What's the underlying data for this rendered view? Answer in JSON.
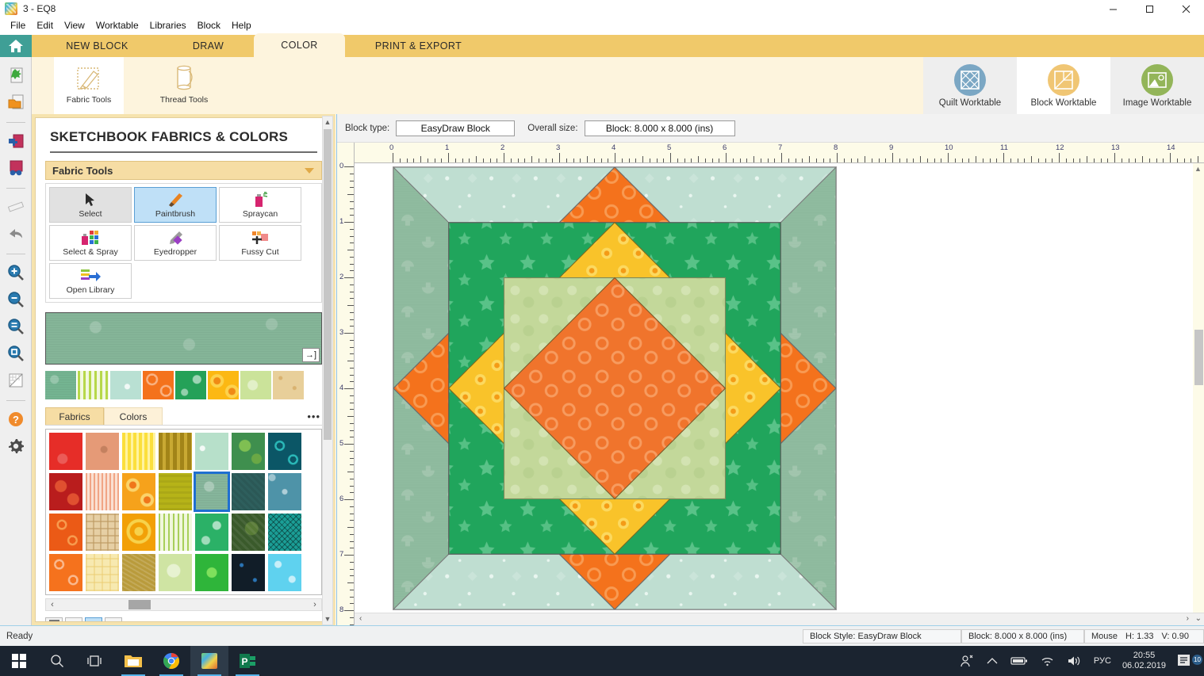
{
  "window": {
    "title": "3 - EQ8",
    "app_icon": "eq8-logo-icon",
    "minimize": "—",
    "maximize": "❐",
    "close": "✕"
  },
  "menu": [
    {
      "label": "File"
    },
    {
      "label": "Edit"
    },
    {
      "label": "View"
    },
    {
      "label": "Worktable"
    },
    {
      "label": "Libraries"
    },
    {
      "label": "Block"
    },
    {
      "label": "Help"
    }
  ],
  "ribbon": {
    "home_icon": "home-icon",
    "tabs": [
      {
        "label": "NEW BLOCK",
        "active": false
      },
      {
        "label": "DRAW",
        "active": false
      },
      {
        "label": "COLOR",
        "active": true
      },
      {
        "label": "PRINT & EXPORT",
        "active": false
      }
    ],
    "buttons": [
      {
        "label": "Fabric Tools",
        "icon": "paintbrush-fabric-icon",
        "active": true
      },
      {
        "label": "Thread Tools",
        "icon": "thread-spool-icon",
        "active": false
      }
    ],
    "worktables": [
      {
        "label": "Quilt Worktable",
        "icon": "quilt-worktable-icon",
        "color": "#7ba7c4",
        "active": false
      },
      {
        "label": "Block Worktable",
        "icon": "block-worktable-icon",
        "color": "#f0c674",
        "active": true
      },
      {
        "label": "Image Worktable",
        "icon": "image-worktable-icon",
        "color": "#93b559",
        "active": false
      }
    ]
  },
  "left_toolbar": [
    {
      "name": "new-file-icon"
    },
    {
      "name": "open-folder-icon"
    },
    {
      "name": "add-to-sketchbook-icon"
    },
    {
      "name": "view-sketchbook-icon"
    },
    {
      "name": "ruler-icon"
    },
    {
      "name": "undo-arrow-icon"
    },
    {
      "name": "zoom-in-icon"
    },
    {
      "name": "zoom-out-icon"
    },
    {
      "name": "fit-to-window-icon"
    },
    {
      "name": "zoom-rectangle-icon"
    },
    {
      "name": "grid-icon"
    },
    {
      "name": "help-icon"
    },
    {
      "name": "settings-gear-icon"
    }
  ],
  "panel": {
    "title": "SKETCHBOOK FABRICS & COLORS",
    "section": {
      "label": "Fabric Tools",
      "collapse_icon": "chevron-down-icon"
    },
    "tools": [
      {
        "label": "Select",
        "icon": "cursor-arrow-icon",
        "state": "pressed"
      },
      {
        "label": "Paintbrush",
        "icon": "paintbrush-icon",
        "state": "selected"
      },
      {
        "label": "Spraycan",
        "icon": "spraycan-icon",
        "state": "normal"
      },
      {
        "label": "Select & Spray",
        "icon": "select-and-spray-icon",
        "state": "normal"
      },
      {
        "label": "Eyedropper",
        "icon": "eyedropper-icon",
        "state": "normal"
      },
      {
        "label": "Fussy Cut",
        "icon": "fussy-cut-icon",
        "state": "normal"
      },
      {
        "label": "Open Library",
        "icon": "open-library-icon",
        "state": "normal"
      }
    ],
    "current_fabric": {
      "name": "current-fabric-preview",
      "color": "#85b598",
      "expand_icon": "→]"
    },
    "recent_swatches": [
      {
        "color": "#74b491",
        "name": "swatch-green-tree"
      },
      {
        "color": "#cde06a",
        "name": "swatch-lime-plaid"
      },
      {
        "color": "#b9e0d3",
        "name": "swatch-pale-aqua"
      },
      {
        "color": "#f4721c",
        "name": "swatch-orange-rings"
      },
      {
        "color": "#24a158",
        "name": "swatch-green-stars"
      },
      {
        "color": "#fcb813",
        "name": "swatch-yellow-rings"
      },
      {
        "color": "#cbe39a",
        "name": "swatch-light-green"
      },
      {
        "color": "#e8cf9a",
        "name": "swatch-tan-dots"
      }
    ],
    "tabs": [
      {
        "label": "Fabrics",
        "active": true
      },
      {
        "label": "Colors",
        "active": false
      }
    ],
    "more_icon": "•••",
    "palette": [
      [
        {
          "color": "#e62d28",
          "name": "palette-red"
        },
        {
          "color": "#e59a77",
          "name": "palette-salmon"
        },
        {
          "color": "#fbdf3c",
          "name": "palette-yellow-stripe"
        },
        {
          "color": "#a28418",
          "name": "palette-olive-gold"
        },
        {
          "color": "#b7e0ca",
          "name": "palette-mint"
        },
        {
          "color": "#3f8f4e",
          "name": "palette-green-leaf"
        },
        {
          "color": "#0b5666",
          "name": "palette-teal-dark"
        }
      ],
      [
        {
          "color": "#b91d1d",
          "name": "palette-dark-red"
        },
        {
          "color": "#f4c6ae",
          "name": "palette-peach-stripe"
        },
        {
          "color": "#f6a21b",
          "name": "palette-orange-rings"
        },
        {
          "color": "#b6b318",
          "name": "palette-chartreuse"
        },
        {
          "color": "#86b59b",
          "name": "palette-sage-selected"
        },
        {
          "color": "#2e5f5d",
          "name": "palette-deep-teal"
        },
        {
          "color": "#4e93a8",
          "name": "palette-blue-clover"
        }
      ],
      [
        {
          "color": "#eb5a16",
          "name": "palette-orange-circles"
        },
        {
          "color": "#e6cfa4",
          "name": "palette-beige-grid"
        },
        {
          "color": "#f2a007",
          "name": "palette-gold-swirl"
        },
        {
          "color": "#cbe493",
          "name": "palette-lime-plaid"
        },
        {
          "color": "#2bb167",
          "name": "palette-green-stars"
        },
        {
          "color": "#3a5a2b",
          "name": "palette-forest"
        },
        {
          "color": "#1b9e96",
          "name": "palette-teal-crosshatch"
        }
      ],
      [
        {
          "color": "#f5721d",
          "name": "palette-orange-rings2"
        },
        {
          "color": "#f7e9b0",
          "name": "palette-cream-plaid"
        },
        {
          "color": "#b99b3c",
          "name": "palette-gold-texture"
        },
        {
          "color": "#cfe4a3",
          "name": "palette-pale-lime"
        },
        {
          "color": "#2fb53a",
          "name": "palette-green-burst"
        },
        {
          "color": "#111d28",
          "name": "palette-navy-black"
        },
        {
          "color": "#5fd2ef",
          "name": "palette-sky-dots"
        }
      ]
    ],
    "selected_cell": {
      "row": 1,
      "col": 4
    },
    "scroll": {
      "left_arrow": "‹",
      "right_arrow": "›"
    },
    "size_buttons": [
      {
        "name": "swatch-size-large",
        "active": false
      },
      {
        "name": "swatch-size-medium",
        "active": false
      },
      {
        "name": "swatch-size-small",
        "active": true
      },
      {
        "name": "swatch-size-tiny",
        "active": false
      }
    ]
  },
  "worktable": {
    "block_type_label": "Block type:",
    "block_type_value": "EasyDraw Block",
    "overall_size_label": "Overall size:",
    "overall_size_value": "Block: 8.000 x 8.000 (ins)",
    "h_ruler_ticks": [
      "0",
      "1",
      "2",
      "3",
      "4",
      "5",
      "6",
      "7",
      "8",
      "9",
      "10",
      "11",
      "12",
      "13",
      "14"
    ],
    "v_ruler_ticks": [
      "0",
      "1",
      "2",
      "3",
      "4",
      "5",
      "6",
      "7",
      "8"
    ]
  },
  "block_design": {
    "name": "quilt-block-canvas",
    "description": "EasyDraw pieced block: corner hourglass triangles, orange on-point square, green star-fabric square, yellow on-point square, pale green square, orange center diamond",
    "fabrics": {
      "bg_light_mint": "#b8ddd0",
      "bg_sage": "#8fbb9f",
      "orange": "#f4721c",
      "green_star": "#20a55c",
      "yellow": "#f9c32a",
      "pale_green": "#c0d797",
      "center_orange": "#f0742c"
    }
  },
  "statusbar": {
    "ready": "Ready",
    "block_style": "Block Style: EasyDraw Block",
    "block_size": "Block: 8.000 x 8.000 (ins)",
    "mouse_label": "Mouse",
    "mouse_h": "H:  1.33",
    "mouse_v": "V:  0.90"
  },
  "taskbar": {
    "items": [
      {
        "name": "start-button-icon"
      },
      {
        "name": "search-icon"
      },
      {
        "name": "task-view-icon"
      },
      {
        "name": "file-explorer-icon",
        "running": true
      },
      {
        "name": "chrome-icon",
        "running": true
      },
      {
        "name": "eq8-icon",
        "running": true,
        "active": true
      },
      {
        "name": "publisher-icon",
        "running": true
      }
    ],
    "tray": {
      "people_icon": "people-icon",
      "chevron_icon": "show-hidden-icons-chevron",
      "battery_icon": "battery-icon",
      "network_icon": "wifi-icon",
      "volume_icon": "volume-icon",
      "language": "РУС",
      "time": "20:55",
      "date": "06.02.2019",
      "notifications_icon": "action-center-icon",
      "notification_count": "10"
    }
  }
}
